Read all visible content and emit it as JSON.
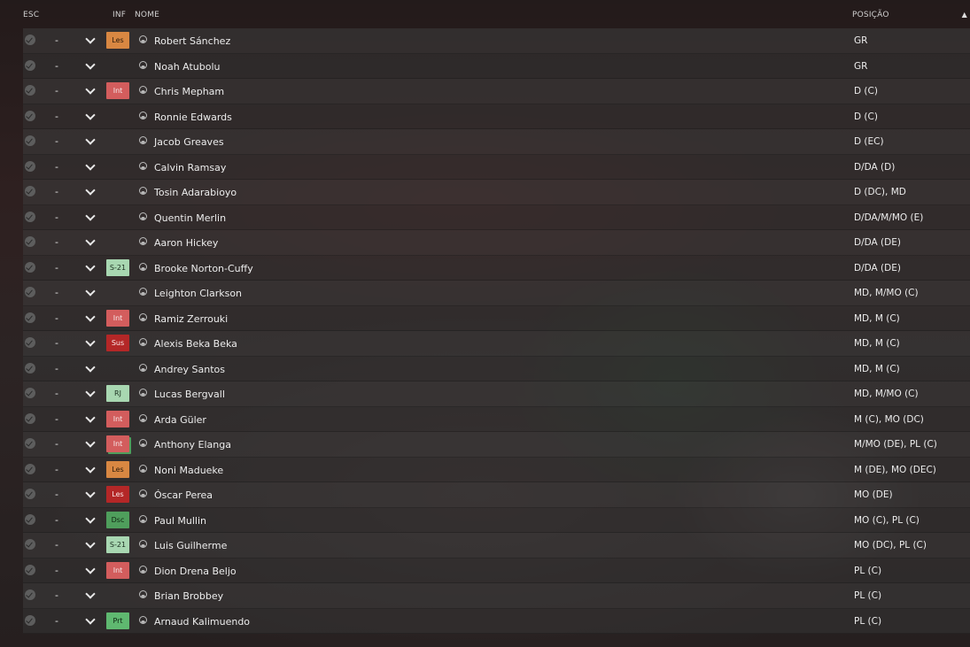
{
  "header": {
    "esc": "ESC",
    "inf": "INF",
    "nome": "NOME",
    "posicao": "POSIÇÃO",
    "sort_icon": "sort-ascending-icon"
  },
  "colors": {
    "les": "#d88742",
    "int": "#d35d5d",
    "s21": "#a8d7b1",
    "sus": "#b42727",
    "rj": "#a8d7b1",
    "dsc": "#4f9e5c",
    "prt": "#5fb870"
  },
  "players": [
    {
      "selection": "-",
      "inf": "Les",
      "inf_type": "les",
      "name": "Robert Sánchez",
      "position": "GR"
    },
    {
      "selection": "-",
      "inf": "",
      "inf_type": "",
      "name": "Noah Atubolu",
      "position": "GR"
    },
    {
      "selection": "-",
      "inf": "Int",
      "inf_type": "int",
      "name": "Chris Mepham",
      "position": "D (C)"
    },
    {
      "selection": "-",
      "inf": "",
      "inf_type": "",
      "name": "Ronnie Edwards",
      "position": "D (C)"
    },
    {
      "selection": "-",
      "inf": "",
      "inf_type": "",
      "name": "Jacob Greaves",
      "position": "D (EC)"
    },
    {
      "selection": "-",
      "inf": "",
      "inf_type": "",
      "name": "Calvin Ramsay",
      "position": "D/DA (D)"
    },
    {
      "selection": "-",
      "inf": "",
      "inf_type": "",
      "name": "Tosin Adarabioyo",
      "position": "D (DC), MD"
    },
    {
      "selection": "-",
      "inf": "",
      "inf_type": "",
      "name": "Quentin Merlin",
      "position": "D/DA/M/MO (E)"
    },
    {
      "selection": "-",
      "inf": "",
      "inf_type": "",
      "name": "Aaron Hickey",
      "position": "D/DA (DE)"
    },
    {
      "selection": "-",
      "inf": "S-21",
      "inf_type": "s21",
      "name": "Brooke Norton-Cuffy",
      "position": "D/DA (DE)"
    },
    {
      "selection": "-",
      "inf": "",
      "inf_type": "",
      "name": "Leighton Clarkson",
      "position": "MD, M/MO (C)"
    },
    {
      "selection": "-",
      "inf": "Int",
      "inf_type": "int",
      "name": "Ramiz Zerrouki",
      "position": "MD, M (C)"
    },
    {
      "selection": "-",
      "inf": "Sus",
      "inf_type": "sus",
      "name": "Alexis Beka Beka",
      "position": "MD, M (C)"
    },
    {
      "selection": "-",
      "inf": "",
      "inf_type": "",
      "name": "Andrey Santos",
      "position": "MD, M (C)"
    },
    {
      "selection": "-",
      "inf": "RJ",
      "inf_type": "rj",
      "name": "Lucas Bergvall",
      "position": "MD, M/MO (C)"
    },
    {
      "selection": "-",
      "inf": "Int",
      "inf_type": "int",
      "name": "Arda Güler",
      "position": "M (C), MO (DC)"
    },
    {
      "selection": "-",
      "inf": "Int",
      "inf_type": "int stack",
      "name": "Anthony Elanga",
      "position": "M/MO (DE), PL (C)"
    },
    {
      "selection": "-",
      "inf": "Les",
      "inf_type": "les",
      "name": "Noni Madueke",
      "position": "M (DE), MO (DEC)"
    },
    {
      "selection": "-",
      "inf": "Les",
      "inf_type": "sus",
      "name": "Óscar Perea",
      "position": "MO (DE)"
    },
    {
      "selection": "-",
      "inf": "Dsc",
      "inf_type": "dsc",
      "name": "Paul Mullin",
      "position": "MO (C), PL (C)"
    },
    {
      "selection": "-",
      "inf": "S-21",
      "inf_type": "s21",
      "name": "Luis Guilherme",
      "position": "MO (DC), PL (C)"
    },
    {
      "selection": "-",
      "inf": "Int",
      "inf_type": "int",
      "name": "Dion Drena Beljo",
      "position": "PL (C)"
    },
    {
      "selection": "-",
      "inf": "",
      "inf_type": "",
      "name": "Brian Brobbey",
      "position": "PL (C)"
    },
    {
      "selection": "-",
      "inf": "Prt",
      "inf_type": "prt",
      "name": "Arnaud Kalimuendo",
      "position": "PL (C)"
    }
  ]
}
